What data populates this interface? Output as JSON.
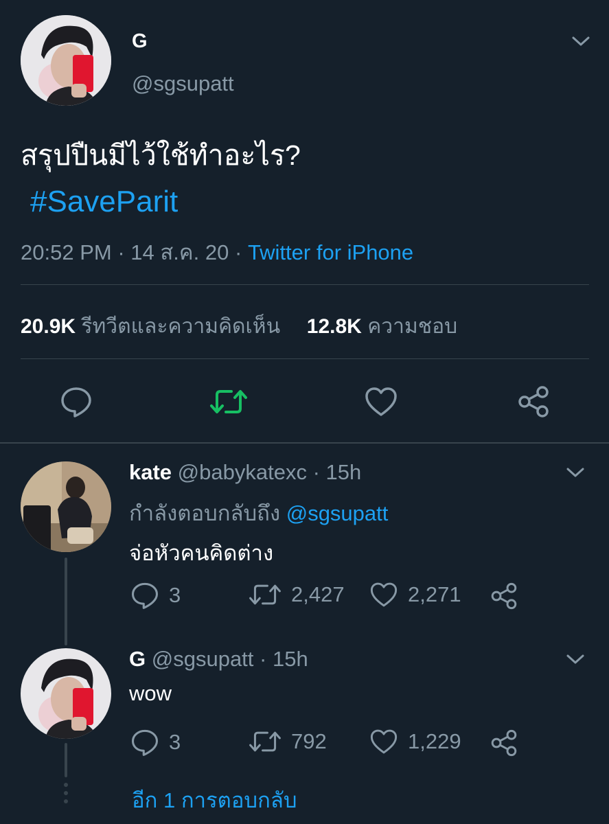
{
  "main_tweet": {
    "author": {
      "name": "G",
      "handle": "@sgsupatt"
    },
    "text": "สรุปปืนมีไว้ใช้ทำอะไร?",
    "hashtag": "#SaveParit",
    "meta": {
      "time": "20:52 PM",
      "date": "14 ส.ค. 20",
      "sep": "·",
      "source": "Twitter for iPhone"
    },
    "stats": {
      "retweets_count": "20.9K",
      "retweets_label": "รีทวีตและความคิดเห็น",
      "likes_count": "12.8K",
      "likes_label": "ความชอบ"
    }
  },
  "replies": [
    {
      "name": "kate",
      "handle": "@babykatexc",
      "time": "15h",
      "sep": "·",
      "replying_prefix": "กำลังตอบกลับถึง",
      "replying_to": "@sgsupatt",
      "text": "จ่อหัวคนคิดต่าง",
      "reply_count": "3",
      "retweet_count": "2,427",
      "like_count": "2,271"
    },
    {
      "name": "G",
      "handle": "@sgsupatt",
      "time": "15h",
      "sep": "·",
      "text": "wow",
      "reply_count": "3",
      "retweet_count": "792",
      "like_count": "1,229"
    }
  ],
  "more_replies_label": "อีก 1 การตอบกลับ",
  "colors": {
    "background": "#15202b",
    "accent": "#1da1f2",
    "retweet_green": "#17bf63",
    "muted": "#8899a6",
    "divider": "#38444d"
  }
}
